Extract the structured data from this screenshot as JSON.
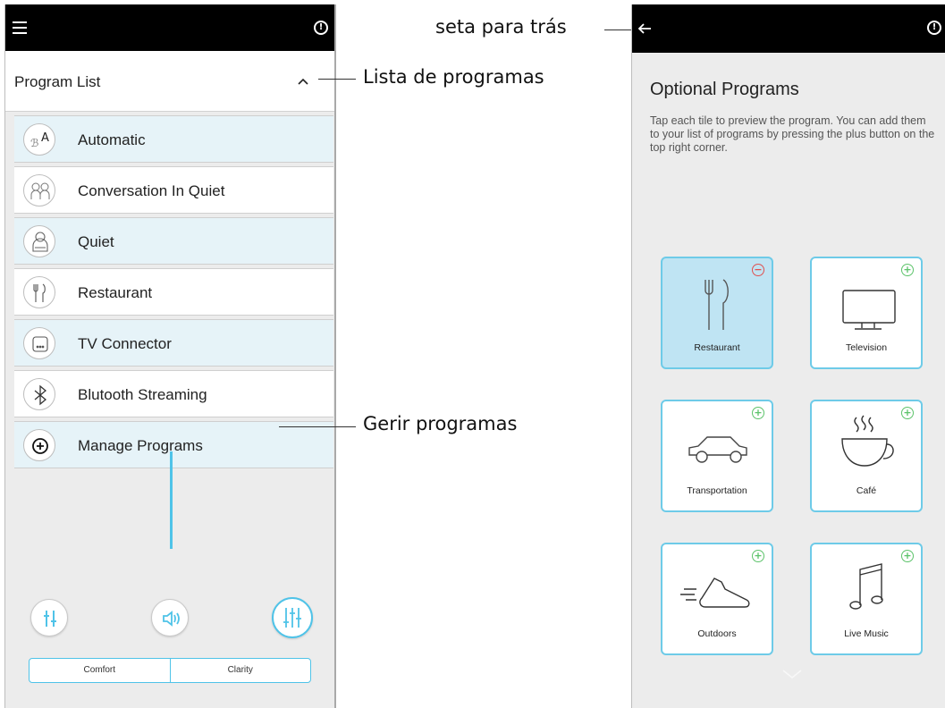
{
  "left_screen": {
    "header": {
      "title": "Program List"
    },
    "programs": [
      {
        "label": "Automatic",
        "icon": "automatic-icon",
        "highlighted": true
      },
      {
        "label": "Conversation In Quiet",
        "icon": "conversation-icon",
        "highlighted": false
      },
      {
        "label": "Quiet",
        "icon": "quiet-icon",
        "highlighted": true
      },
      {
        "label": "Restaurant",
        "icon": "restaurant-icon",
        "highlighted": false
      },
      {
        "label": "TV Connector",
        "icon": "tv-connector-icon",
        "highlighted": true
      },
      {
        "label": "Blutooth Streaming",
        "icon": "bluetooth-icon",
        "highlighted": false
      },
      {
        "label": "Manage Programs",
        "icon": "plus-circle-icon",
        "highlighted": true
      }
    ],
    "modes": {
      "comfort": "Comfort",
      "clarity": "Clarity"
    }
  },
  "annotations": {
    "back_arrow": "seta para trás",
    "program_list": "Lista de programas",
    "manage_programs": "Gerir programas"
  },
  "right_screen": {
    "title": "Optional Programs",
    "description": "Tap each tile to preview the program. You can add them to your list of programs by pressing the plus button on the top right corner.",
    "tiles": [
      {
        "label": "Restaurant",
        "icon": "fork-knife-icon",
        "state": "added"
      },
      {
        "label": "Television",
        "icon": "television-icon",
        "state": "available"
      },
      {
        "label": "Transportation",
        "icon": "car-icon",
        "state": "available"
      },
      {
        "label": "Café",
        "icon": "coffee-cup-icon",
        "state": "available"
      },
      {
        "label": "Outdoors",
        "icon": "running-shoe-icon",
        "state": "available"
      },
      {
        "label": "Live Music",
        "icon": "music-note-icon",
        "state": "available"
      }
    ]
  },
  "colors": {
    "accent": "#4fc3e8",
    "highlight_row": "#e6f3f8",
    "selected_tile": "#bfe4f3",
    "add_badge": "#5cc36a",
    "remove_badge": "#e0504f",
    "topbar": "#000000"
  }
}
